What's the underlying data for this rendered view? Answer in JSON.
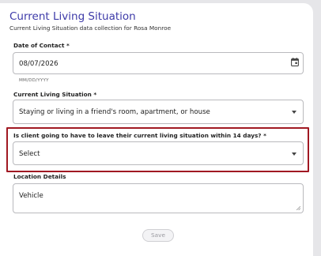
{
  "header": {
    "title": "Current Living Situation",
    "subtitle": "Current Living Situation data collection for Rosa Monroe"
  },
  "fields": {
    "date_of_contact": {
      "label": "Date of Contact *",
      "value": "08/07/2026",
      "helper": "MM/DD/YYYY",
      "icon": "calendar-icon"
    },
    "current_living_situation": {
      "label": "Current Living Situation *",
      "value": "Staying or living in a friend's room, apartment, or house"
    },
    "leave_within_14_days": {
      "label": "Is client going to have to leave their current living situation within 14 days? *",
      "value": "Select"
    },
    "location_details": {
      "label": "Location Details",
      "value": "Vehicle"
    }
  },
  "actions": {
    "save_label": "Save"
  },
  "colors": {
    "title": "#3d3aa8",
    "highlight_border": "#a01822",
    "background": "#e6e6e9"
  }
}
